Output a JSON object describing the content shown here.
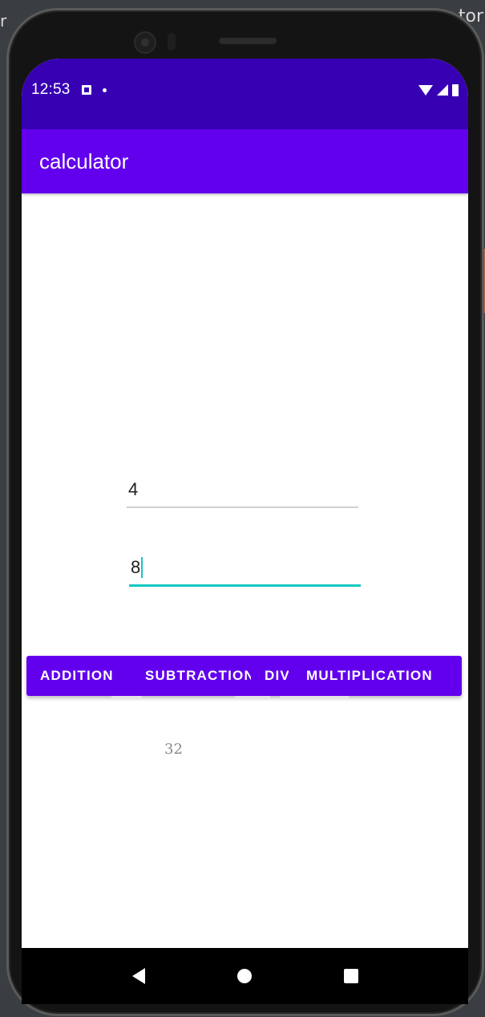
{
  "status_bar": {
    "time": "12:53"
  },
  "app_bar": {
    "title": "calculator"
  },
  "inputs": {
    "first_value": "4",
    "second_value": "8"
  },
  "buttons": {
    "addition": "ADDITION",
    "subtraction": "SUBTRACTION",
    "division": "DIVISION",
    "multiplication": "MULTIPLICATION"
  },
  "result": {
    "value": "32"
  },
  "colors": {
    "status_bar": "#3700b3",
    "primary": "#6200ee",
    "accent": "#14c7c0"
  },
  "icons": {
    "status": [
      "notification-icon",
      "dot-icon",
      "wifi-icon",
      "signal-icon",
      "battery-icon"
    ],
    "nav": [
      "back-icon",
      "home-icon",
      "recents-icon"
    ]
  }
}
